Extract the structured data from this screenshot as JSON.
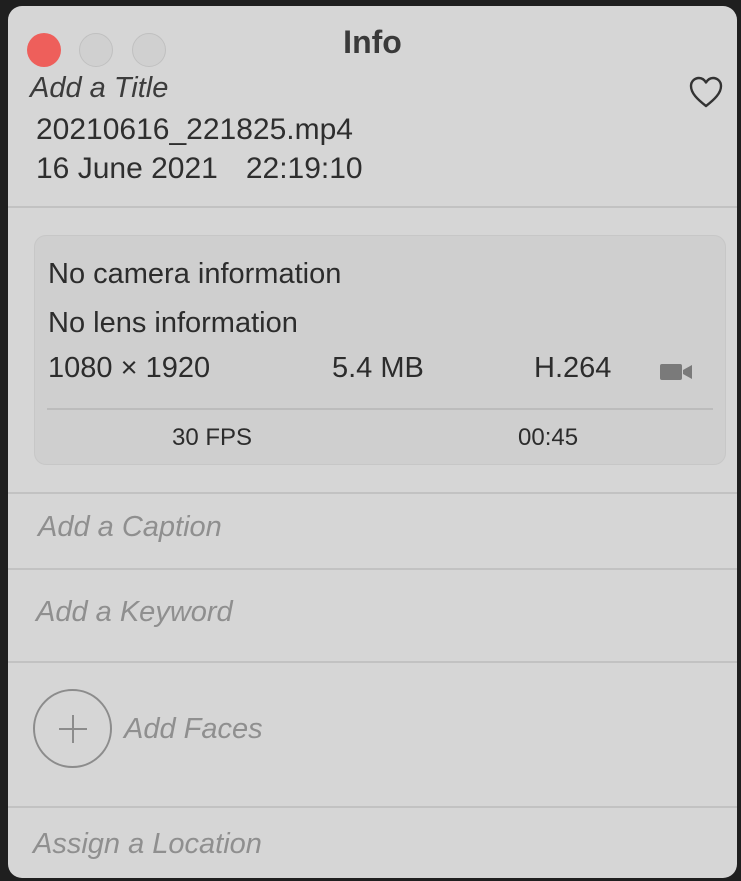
{
  "window": {
    "title": "Info"
  },
  "header": {
    "title_placeholder": "Add a Title",
    "filename": "20210616_221825.mp4",
    "date": "16 June 2021",
    "time": "22:19:10"
  },
  "media_info": {
    "camera": "No camera information",
    "lens": "No lens information",
    "resolution": "1080 × 1920",
    "size": "5.4 MB",
    "codec": "H.264",
    "fps": "30 FPS",
    "duration": "00:45"
  },
  "fields": {
    "caption": "Add a Caption",
    "keyword": "Add a Keyword",
    "faces": "Add Faces",
    "location": "Assign a Location"
  },
  "icons": {
    "heart": "heart-icon",
    "video": "video-camera-icon",
    "add": "plus-icon"
  },
  "colors": {
    "close": "#ee5f5b",
    "panel_bg": "#d6d6d6",
    "placeholder": "#8f8f8f"
  }
}
